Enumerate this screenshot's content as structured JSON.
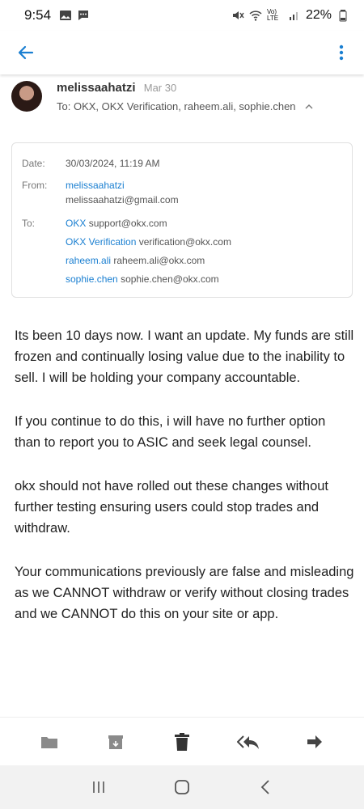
{
  "status_bar": {
    "time": "9:54",
    "battery": "22%",
    "network": "Vo) LTE"
  },
  "header": {
    "sender": "melissaahatzi",
    "date": "Mar 30",
    "to_line": "To: OKX, OKX Verification, raheem.ali, sophie.chen"
  },
  "details": {
    "date_label": "Date:",
    "date_value": "30/03/2024, 11:19 AM",
    "from_label": "From:",
    "from_name": "melissaahatzi",
    "from_email": "melissaahatzi@gmail.com",
    "to_label": "To:",
    "recipients": [
      {
        "name": "OKX",
        "email": "support@okx.com"
      },
      {
        "name": "OKX Verification",
        "email": "verification@okx.com"
      },
      {
        "name": "raheem.ali",
        "email": "raheem.ali@okx.com"
      },
      {
        "name": "sophie.chen",
        "email": "sophie.chen@okx.com"
      }
    ]
  },
  "body": {
    "paragraphs": [
      "Its been 10 days now. I want an update. My funds are still frozen and continually losing value due to the inability to sell. I will be holding your company accountable.",
      "If you continue to do this, i will have no further option than to report you to ASIC and seek legal counsel.",
      "okx should not have rolled out these changes without further testing ensuring users could stop trades and withdraw.",
      "Your communications previously are false and misleading as we CANNOT withdraw or verify without closing trades and we CANNOT do this on your site or app."
    ]
  },
  "actions": [
    "folder-icon",
    "archive-icon",
    "trash-icon",
    "reply-all-icon",
    "forward-icon"
  ],
  "colors": {
    "accent": "#1a7fd1"
  }
}
